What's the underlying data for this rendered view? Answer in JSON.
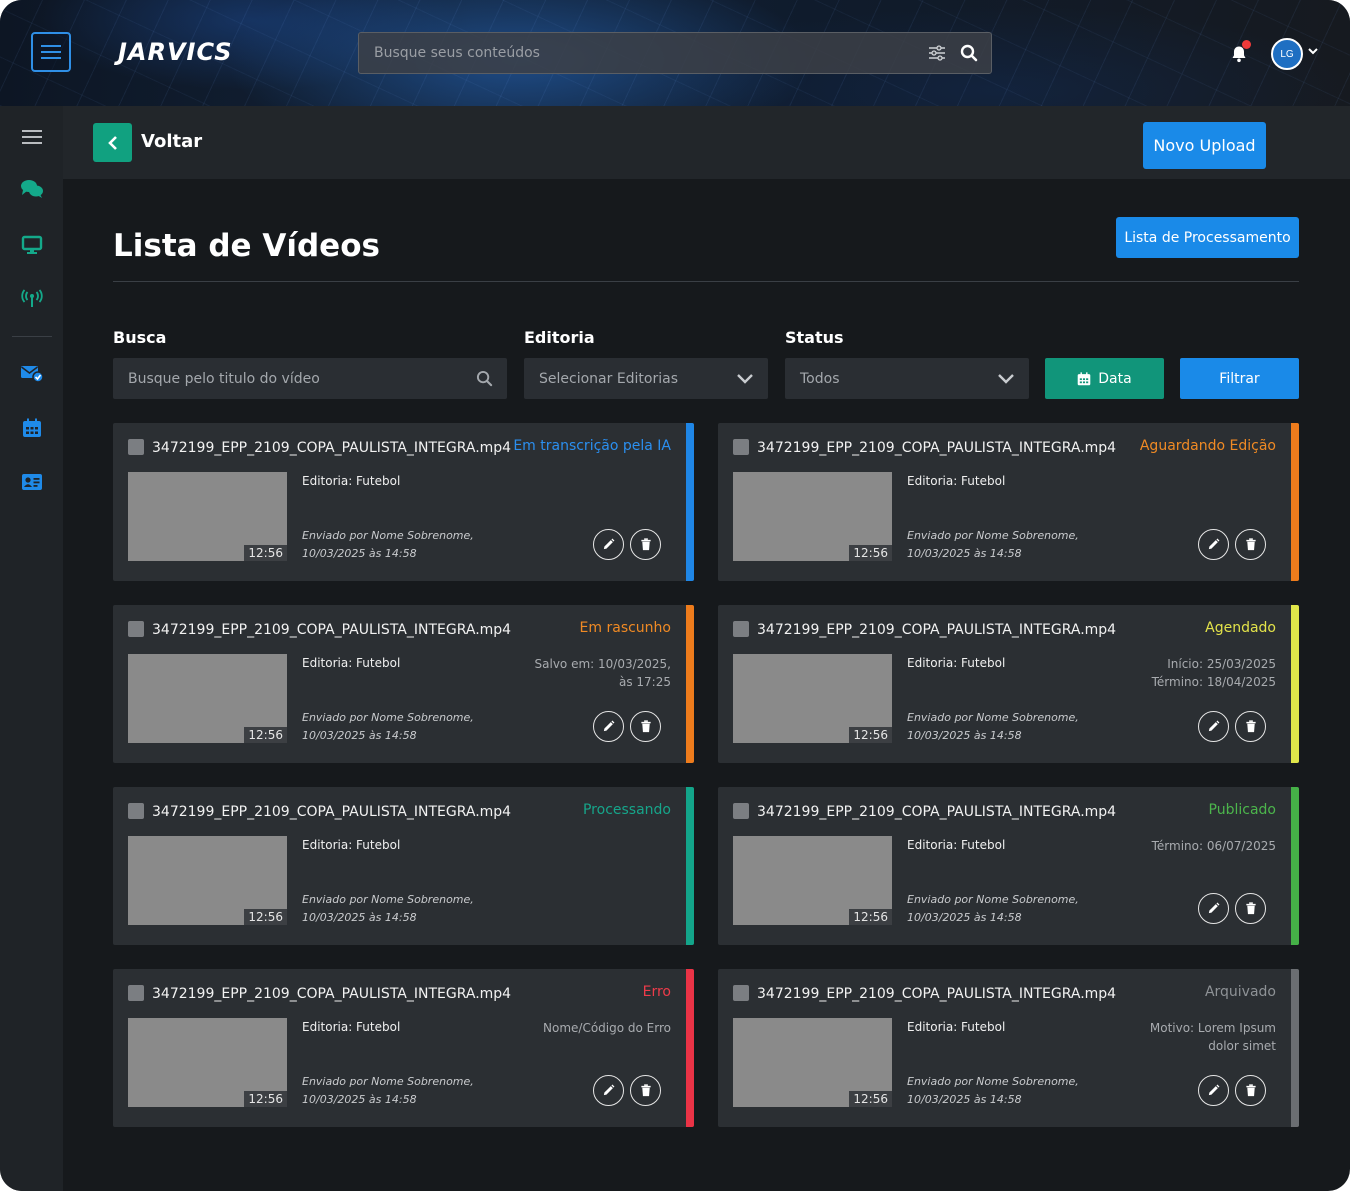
{
  "header": {
    "logo_text": "JARVICS",
    "search_placeholder": "Busque seus conteúdos",
    "avatar_initials": "LG",
    "notification_dot_color": "#ef3a3a"
  },
  "sidebar": {
    "items": [
      {
        "icon": "menu-icon"
      },
      {
        "icon": "chat-icon"
      },
      {
        "icon": "monitor-icon"
      },
      {
        "icon": "broadcast-icon"
      },
      {
        "icon": "mail-check-icon"
      },
      {
        "icon": "calendar-icon"
      },
      {
        "icon": "id-card-icon"
      }
    ]
  },
  "subheader": {
    "back_label": "Voltar",
    "upload_label": "Novo Upload"
  },
  "page": {
    "title": "Lista de Vídeos",
    "processing_button": "Lista de Processamento"
  },
  "filters": {
    "search_label": "Busca",
    "search_placeholder": "Busque pelo titulo do vídeo",
    "editoria_label": "Editoria",
    "editoria_value": "Selecionar Editorias",
    "status_label": "Status",
    "status_value": "Todos",
    "date_button": "Data",
    "filter_button": "Filtrar"
  },
  "cards": [
    {
      "filename": "3472199_EPP_2109_COPA_PAULISTA_INTEGRA.mp4",
      "status": "Em transcrição pela IA",
      "status_color": "#2b8ff0",
      "accent": "#1f86e6",
      "duration": "12:56",
      "editoria": "Editoria: Futebol",
      "sent_line1": "Enviado por Nome Sobrenome,",
      "sent_line2": "10/03/2025 às 14:58",
      "extra1": "",
      "extra2": "",
      "actions": true
    },
    {
      "filename": "3472199_EPP_2109_COPA_PAULISTA_INTEGRA.mp4",
      "status": "Aguardando Edição",
      "status_color": "#f08a24",
      "accent": "#ee7c1c",
      "duration": "12:56",
      "editoria": "Editoria: Futebol",
      "sent_line1": "Enviado por Nome Sobrenome,",
      "sent_line2": "10/03/2025 às 14:58",
      "extra1": "",
      "extra2": "",
      "actions": true
    },
    {
      "filename": "3472199_EPP_2109_COPA_PAULISTA_INTEGRA.mp4",
      "status": "Em rascunho",
      "status_color": "#f08a24",
      "accent": "#ee7c1c",
      "duration": "12:56",
      "editoria": "Editoria: Futebol",
      "sent_line1": "Enviado por Nome Sobrenome,",
      "sent_line2": "10/03/2025 às 14:58",
      "extra1": "Salvo em: 10/03/2025,",
      "extra2": "às 17:25",
      "actions": true
    },
    {
      "filename": "3472199_EPP_2109_COPA_PAULISTA_INTEGRA.mp4",
      "status": "Agendado",
      "status_color": "#e3e34a",
      "accent": "#e0e64a",
      "duration": "12:56",
      "editoria": "Editoria: Futebol",
      "sent_line1": "Enviado por Nome Sobrenome,",
      "sent_line2": "10/03/2025 às 14:58",
      "extra1": "Início: 25/03/2025",
      "extra2": "Término: 18/04/2025",
      "actions": true
    },
    {
      "filename": "3472199_EPP_2109_COPA_PAULISTA_INTEGRA.mp4",
      "status": "Processando",
      "status_color": "#16a58a",
      "accent": "#13a58a",
      "duration": "12:56",
      "editoria": "Editoria: Futebol",
      "sent_line1": "Enviado por Nome Sobrenome,",
      "sent_line2": "10/03/2025 às 14:58",
      "extra1": "",
      "extra2": "",
      "actions": false
    },
    {
      "filename": "3472199_EPP_2109_COPA_PAULISTA_INTEGRA.mp4",
      "status": "Publicado",
      "status_color": "#4cb54c",
      "accent": "#45b047",
      "duration": "12:56",
      "editoria": "Editoria: Futebol",
      "sent_line1": "Enviado por Nome Sobrenome,",
      "sent_line2": "10/03/2025 às 14:58",
      "extra1": "Término: 06/07/2025",
      "extra2": "",
      "actions": true
    },
    {
      "filename": "3472199_EPP_2109_COPA_PAULISTA_INTEGRA.mp4",
      "status": "Erro",
      "status_color": "#ee3b4a",
      "accent": "#ea3346",
      "duration": "12:56",
      "editoria": "Editoria: Futebol",
      "sent_line1": "Enviado por Nome Sobrenome,",
      "sent_line2": "10/03/2025 às 14:58",
      "extra1": "Nome/Código do Erro",
      "extra2": "",
      "actions": true
    },
    {
      "filename": "3472199_EPP_2109_COPA_PAULISTA_INTEGRA.mp4",
      "status": "Arquivado",
      "status_color": "#8e9296",
      "accent": "#6b6e72",
      "duration": "12:56",
      "editoria": "Editoria: Futebol",
      "sent_line1": "Enviado por Nome Sobrenome,",
      "sent_line2": "10/03/2025 às 14:58",
      "extra1": "Motivo: Lorem Ipsum",
      "extra2": "dolor simet",
      "actions": true
    }
  ]
}
